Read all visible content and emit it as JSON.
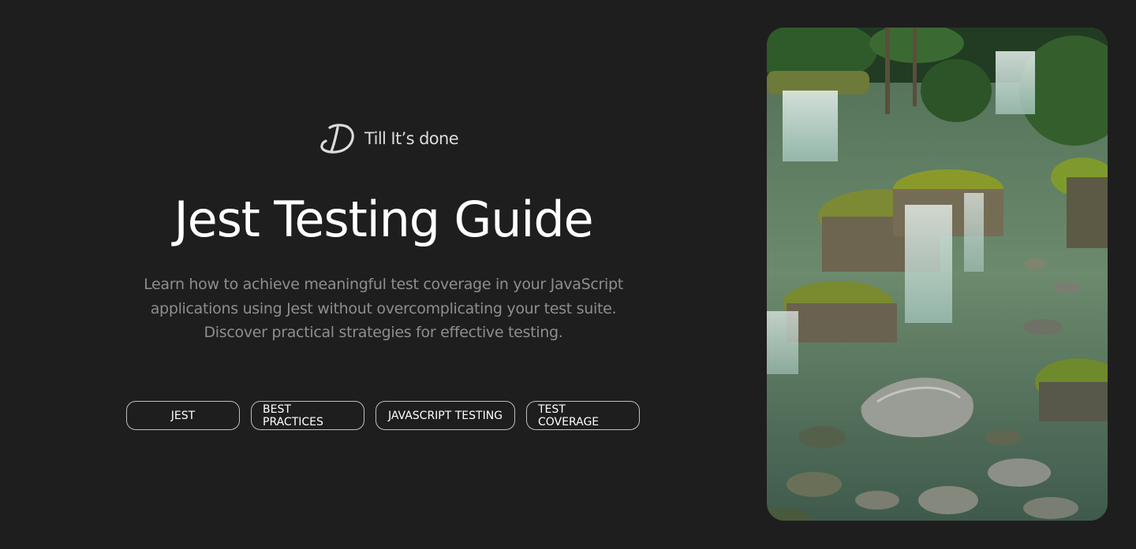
{
  "brand": {
    "logo_icon": "script-d-logo-icon",
    "name": "Till It’s done"
  },
  "hero": {
    "title": "Jest Testing Guide",
    "description": "Learn how to achieve meaningful test coverage in your JavaScript applications using Jest without overcomplicating your test suite. Discover practical strategies for effective testing."
  },
  "tags": [
    {
      "label": "JEST"
    },
    {
      "label": "BEST PRACTICES"
    },
    {
      "label": "JAVASCRIPT TESTING"
    },
    {
      "label": "TEST COVERAGE"
    }
  ],
  "image": {
    "subject": "waterfall-garden-image",
    "colors": {
      "water": "#5c7a62",
      "moss": "#8a9a2a",
      "stone": "#8c8f88",
      "foliage": "#2f5a2a"
    }
  },
  "colors": {
    "background": "#1e1e1e",
    "text": "#ffffff",
    "muted_text": "#8e8e8e",
    "tag_border": "#bfbfbf"
  }
}
